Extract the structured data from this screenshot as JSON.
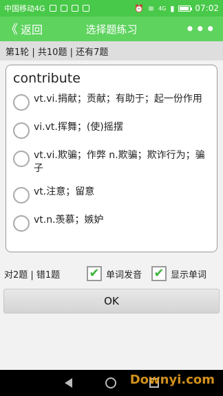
{
  "statusbar": {
    "carrier": "中国移动4G",
    "network": "4G",
    "time": "07:02"
  },
  "navbar": {
    "back_label": "返回",
    "back_chevron": "《",
    "title": "选择题练习",
    "more": "•••"
  },
  "progress": {
    "text": "第1轮 | 共10题 | 还有7题"
  },
  "question": {
    "word": "contribute",
    "options": [
      {
        "text": "vt.vi.捐献；贡献；有助于；起一份作用"
      },
      {
        "text": "vi.vt.挥舞；(使)摇摆"
      },
      {
        "text": "vt.vi.欺骗；作弊 n.欺骗；欺诈行为；骗子"
      },
      {
        "text": "vt.注意；留意"
      },
      {
        "text": "vt.n.羡慕；嫉妒"
      }
    ]
  },
  "stats": {
    "score": "对2题 | 错1题",
    "pronounce_label": "单词发音",
    "pronounce_checked": true,
    "show_word_label": "显示单词",
    "show_word_checked": true
  },
  "ok_button": {
    "label": "OK"
  },
  "watermark": {
    "text": "Downyi.com"
  },
  "colors": {
    "accent": "#5ed35e",
    "statusbar": "#49c949"
  }
}
